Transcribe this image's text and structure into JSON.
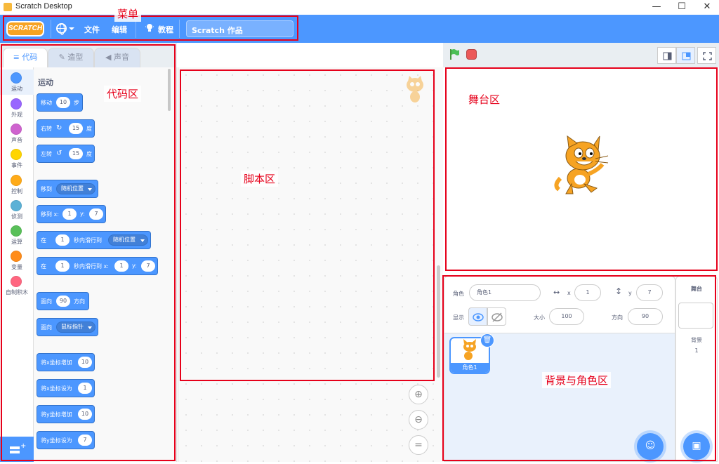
{
  "window": {
    "title": "Scratch Desktop",
    "minimize": "—",
    "maximize": "☐",
    "close": "✕"
  },
  "menu": {
    "logo": "SCRATCH",
    "file": "文件",
    "edit": "编辑",
    "tutorials": "教程",
    "project_title": "Scratch 作品"
  },
  "tabs": {
    "code": "代码",
    "costumes": "造型",
    "sounds": "声音"
  },
  "categories": [
    {
      "label": "运动",
      "color": "#4c97ff"
    },
    {
      "label": "外观",
      "color": "#9966ff"
    },
    {
      "label": "声音",
      "color": "#cf63cf"
    },
    {
      "label": "事件",
      "color": "#ffd500"
    },
    {
      "label": "控制",
      "color": "#ffab19"
    },
    {
      "label": "侦测",
      "color": "#5cb1d6"
    },
    {
      "label": "运算",
      "color": "#59c059"
    },
    {
      "label": "变量",
      "color": "#ff8c1a"
    },
    {
      "label": "自制积木",
      "color": "#ff6680"
    }
  ],
  "palette": {
    "heading": "运动",
    "move": {
      "text1": "移动",
      "value": "10",
      "text2": "步"
    },
    "turn_right": {
      "text1": "右转",
      "value": "15",
      "text2": "度"
    },
    "turn_left": {
      "text1": "左转",
      "value": "15",
      "text2": "度"
    },
    "goto": {
      "text1": "移到",
      "option": "随机位置"
    },
    "goto_xy": {
      "text1": "移到 x:",
      "x": "1",
      "ylabel": "y:",
      "y": "7"
    },
    "glide_to": {
      "text1": "在",
      "secs": "1",
      "text2": "秒内滑行到",
      "option": "随机位置"
    },
    "glide_xy": {
      "text1": "在",
      "secs": "1",
      "text2": "秒内滑行到 x:",
      "x": "1",
      "ylabel": "y:",
      "y": "7"
    },
    "point_dir": {
      "text1": "面向",
      "value": "90",
      "text2": "方向"
    },
    "point_towards": {
      "text1": "面向",
      "option": "鼠标指针"
    },
    "change_x": {
      "text1": "将x坐标增加",
      "value": "10"
    },
    "set_x": {
      "text1": "将x坐标设为",
      "value": "1"
    },
    "change_y": {
      "text1": "将y坐标增加",
      "value": "10"
    },
    "set_y": {
      "text1": "将y坐标设为",
      "value": "7"
    }
  },
  "sprite_info": {
    "sprite_label": "角色",
    "sprite_name": "角色1",
    "x_label": "x",
    "x": "1",
    "y_label": "y",
    "y": "7",
    "show_label": "显示",
    "size_label": "大小",
    "size": "100",
    "direction_label": "方向",
    "direction": "90"
  },
  "sprites": [
    {
      "name": "角色1"
    }
  ],
  "stage_panel": {
    "title": "舞台",
    "backdrops_label": "背景",
    "backdrops_count": "1"
  },
  "annotations": {
    "menu": "菜单",
    "code_area": "代码区",
    "script_area": "脚本区",
    "stage_area": "舞台区",
    "sprite_area": "背景与角色区"
  },
  "annotation_color": "#e6001a",
  "accent_color": "#4c97ff"
}
